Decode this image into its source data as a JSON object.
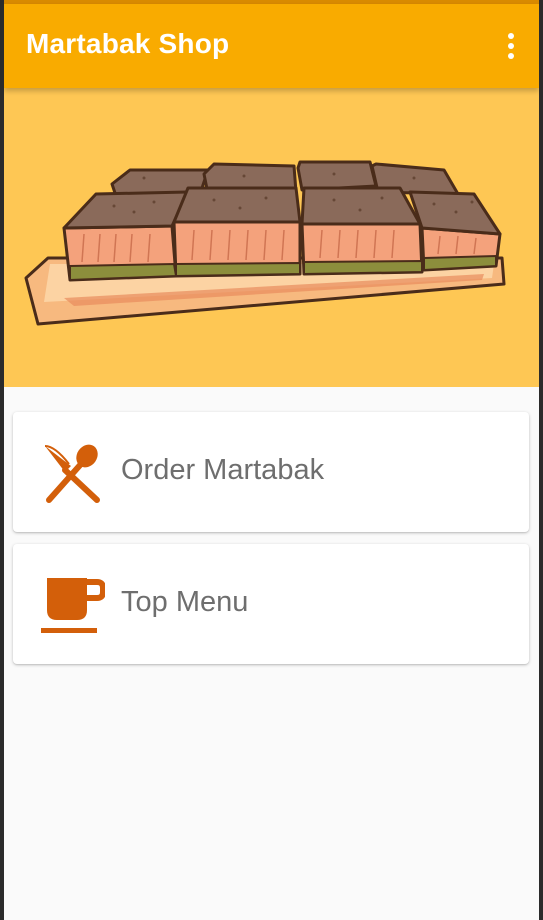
{
  "app_bar": {
    "title": "Martabak Shop",
    "overflow_icon": "more-vert-icon"
  },
  "hero": {
    "image_subject": "martabak-illustration",
    "background_color": "#fec754"
  },
  "menu": [
    {
      "label": "Order Martabak",
      "icon": "fork-spoon-icon"
    },
    {
      "label": "Top Menu",
      "icon": "coffee-cup-icon"
    }
  ],
  "colors": {
    "accent": "#f9ab00",
    "icon": "#d35f0a",
    "label": "#6e6e6e",
    "background": "#fafafa"
  }
}
